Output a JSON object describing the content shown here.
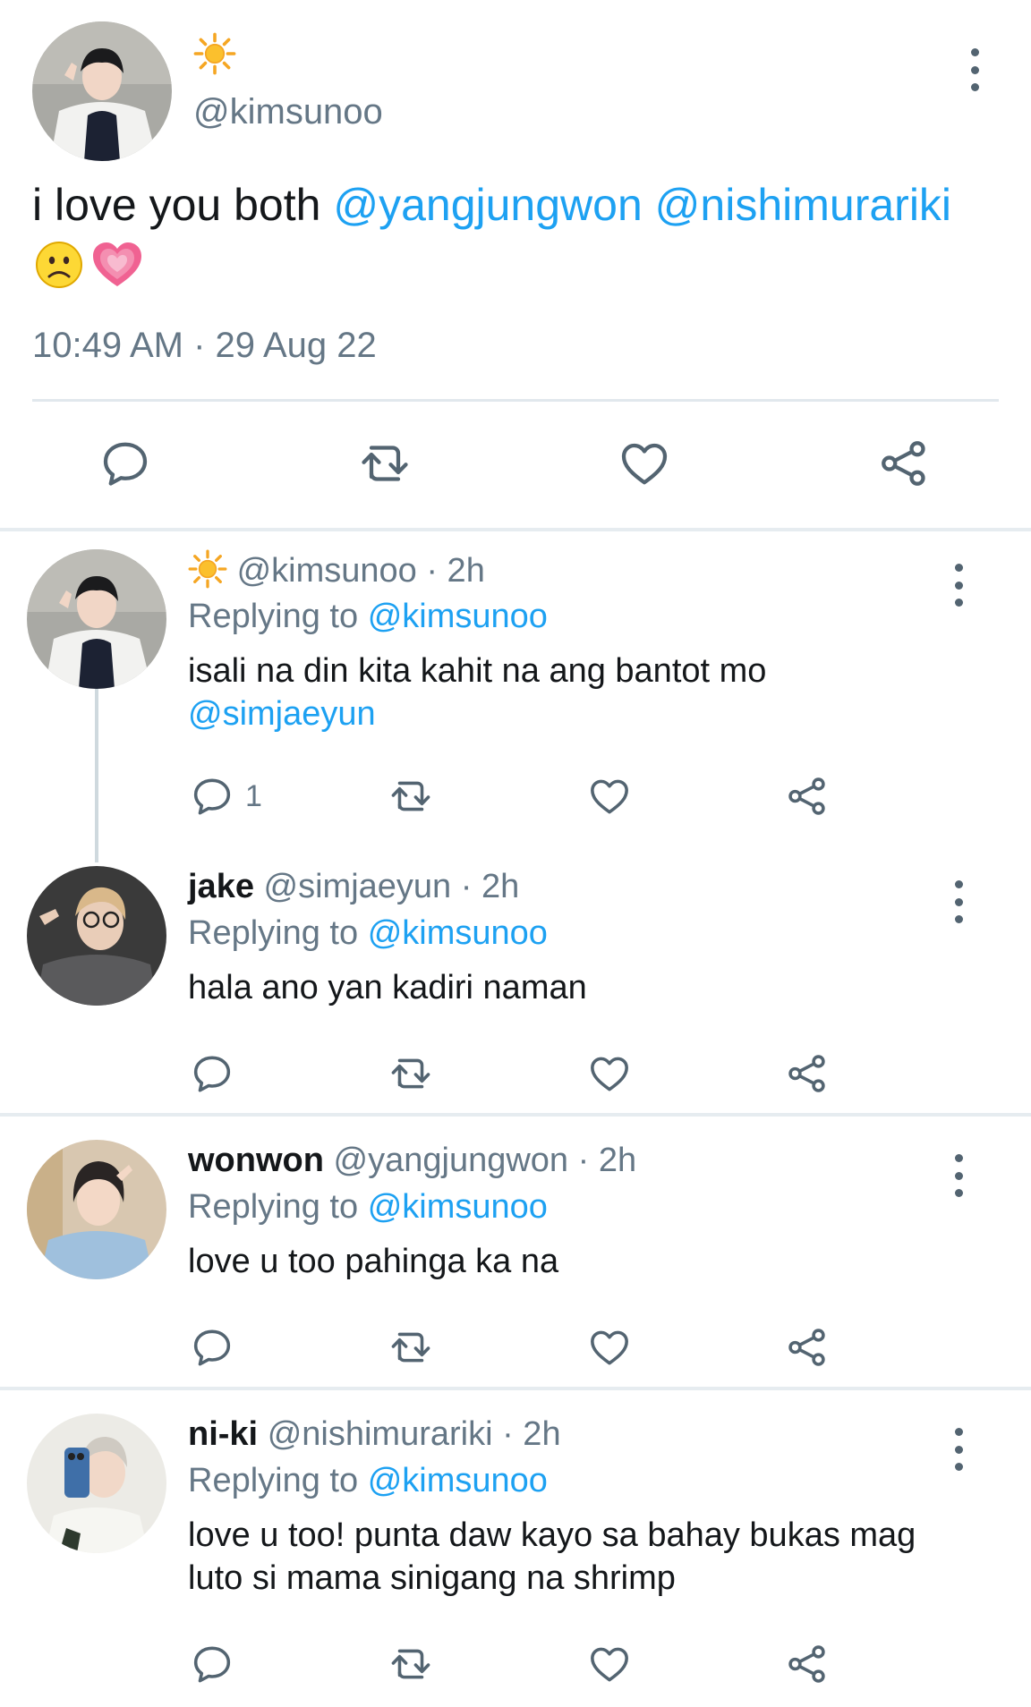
{
  "colors": {
    "link": "#1da1f2",
    "secondary_text": "#657786",
    "icon": "#536471",
    "divider": "#e6ecf0"
  },
  "main_tweet": {
    "display_name_emoji": "sun-emoji",
    "handle": "@kimsunoo",
    "text_prefix": "i love you both ",
    "mentions": [
      "@yangjungwon",
      "@nishimurariki"
    ],
    "emojis": [
      "frowning-face-emoji",
      "growing-heart-emoji"
    ],
    "timestamp": "10:49 AM · 29 Aug 22",
    "actions": [
      "reply-icon",
      "retweet-icon",
      "like-icon",
      "share-icon"
    ]
  },
  "replies": [
    {
      "name_emoji": "sun-emoji",
      "name": "",
      "handle": "@kimsunoo",
      "time": "· 2h",
      "replying_label": "Replying to",
      "replying_to": "@kimsunoo",
      "text": "isali na din kita kahit na ang bantot mo",
      "text_mention": "@simjaeyun",
      "reply_count": "1"
    },
    {
      "name": "jake",
      "handle": "@simjaeyun",
      "time": "· 2h",
      "replying_label": "Replying to",
      "replying_to": "@kimsunoo",
      "text": "hala ano yan kadiri naman"
    },
    {
      "name": "wonwon",
      "handle": "@yangjungwon",
      "time": "· 2h",
      "replying_label": "Replying to",
      "replying_to": "@kimsunoo",
      "text": "love u too pahinga ka na"
    },
    {
      "name": "ni-ki",
      "handle": "@nishimurariki",
      "time": "· 2h",
      "replying_label": "Replying to",
      "replying_to": "@kimsunoo",
      "text": "love u too! punta daw kayo sa bahay bukas mag luto si mama sinigang na shrimp"
    }
  ]
}
